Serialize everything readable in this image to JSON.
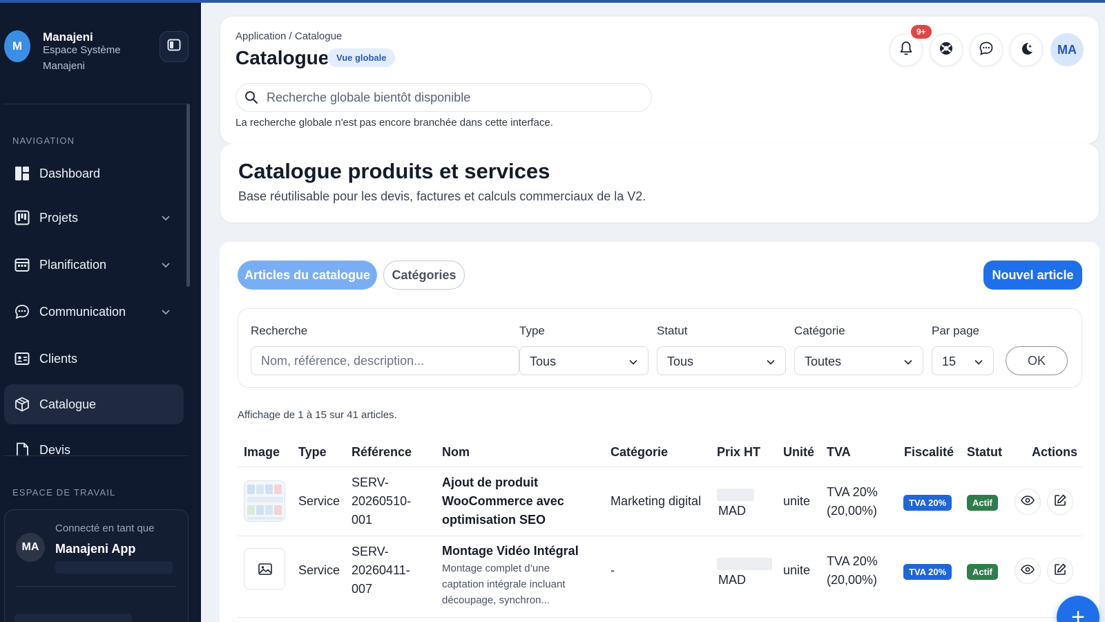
{
  "sidebar": {
    "brand_initial": "M",
    "brand_name": "Manajeni",
    "brand_sub": "Espace Système Manajeni",
    "nav_section": "NAVIGATION",
    "items": [
      {
        "label": "Dashboard",
        "icon": "dashboard-icon"
      },
      {
        "label": "Projets",
        "icon": "kanban-icon",
        "expandable": true
      },
      {
        "label": "Planification",
        "icon": "calendar-icon",
        "expandable": true
      },
      {
        "label": "Communication",
        "icon": "chat-icon",
        "expandable": true
      },
      {
        "label": "Clients",
        "icon": "id-card-icon"
      },
      {
        "label": "Catalogue",
        "icon": "box-icon",
        "active": true
      },
      {
        "label": "Devis",
        "icon": "document-icon"
      }
    ],
    "workspace_section": "ESPACE DE TRAVAIL",
    "user": {
      "initials": "MA",
      "caption": "Connecté en tant que",
      "name": "Manajeni App"
    }
  },
  "header": {
    "breadcrumb": "Application / Catalogue",
    "title": "Catalogue",
    "badge": "Vue globale",
    "search_placeholder": "Recherche globale bientôt disponible",
    "search_hint": "La recherche globale n'est pas encore branchée dans cette interface.",
    "notification_count": "9+",
    "user_initials": "MA"
  },
  "hero": {
    "title": "Catalogue produits et services",
    "subtitle": "Base réutilisable pour les devis, factures et calculs commerciaux de la V2."
  },
  "tabs": {
    "articles": "Articles du catalogue",
    "categories": "Catégories"
  },
  "new_article_label": "Nouvel article",
  "filters": {
    "search_label": "Recherche",
    "search_placeholder": "Nom, référence, description...",
    "type_label": "Type",
    "type_value": "Tous",
    "status_label": "Statut",
    "status_value": "Tous",
    "category_label": "Catégorie",
    "category_value": "Toutes",
    "per_page_label": "Par page",
    "per_page_value": "15",
    "ok_label": "OK"
  },
  "result_count": "Affichage de 1 à 15 sur 41 articles.",
  "table": {
    "headers": [
      "Image",
      "Type",
      "Référence",
      "Nom",
      "Catégorie",
      "Prix HT",
      "Unité",
      "TVA",
      "Fiscalité",
      "Statut",
      "Actions"
    ],
    "rows": [
      {
        "type": "Service",
        "reference": "SERV-20260510-001",
        "ref_lines": [
          "SERV-",
          "20260510-",
          "001"
        ],
        "name_lines": [
          "Ajout de produit",
          "WooCommerce avec",
          "optimisation SEO"
        ],
        "description_lines": [],
        "category": "Marketing digital",
        "currency": "MAD",
        "unit": "unite",
        "tva_lines": [
          "TVA 20%",
          "(20,00%)"
        ],
        "fiscal_badge": "TVA 20%",
        "status_badge": "Actif"
      },
      {
        "type": "Service",
        "reference": "SERV-20260411-007",
        "ref_lines": [
          "SERV-",
          "20260411-",
          "007"
        ],
        "name_lines": [
          "Montage Vidéo Intégral"
        ],
        "description_lines": [
          "Montage complet d’une",
          "captation intégrale incluant",
          "découpage, synchron..."
        ],
        "category": "-",
        "currency": "MAD",
        "unit": "unite",
        "tva_lines": [
          "TVA 20%",
          "(20,00%)"
        ],
        "fiscal_badge": "TVA 20%",
        "status_badge": "Actif"
      }
    ]
  },
  "fab_label": "+"
}
